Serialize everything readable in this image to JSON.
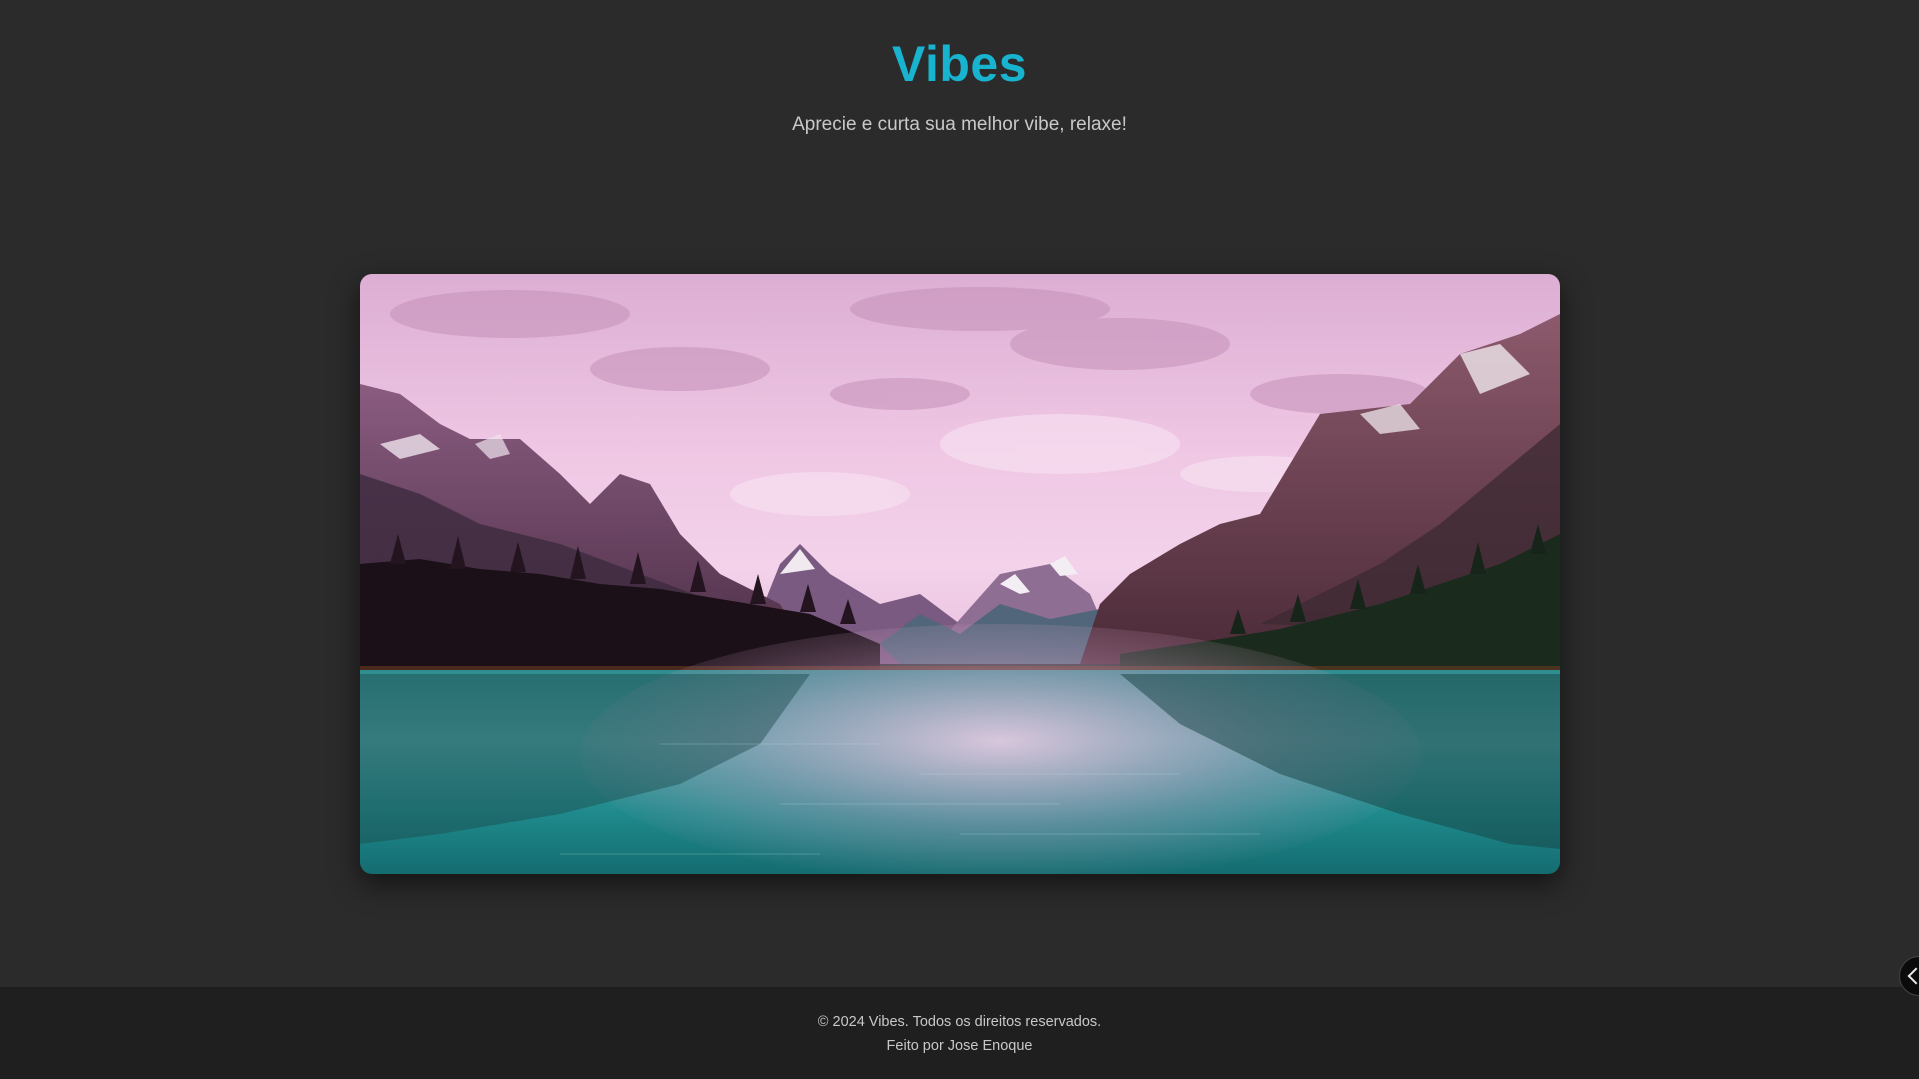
{
  "header": {
    "title": "Vibes",
    "subtitle": "Aprecie e curta sua melhor vibe, relaxe!"
  },
  "hero": {
    "image": "mountain-lake-landscape"
  },
  "footer": {
    "copyright": "© 2024 Vibes. Todos os direitos reservados.",
    "credit": "Feito por Jose Enoque"
  },
  "side_toggle": {
    "icon": "chevron-left-icon"
  },
  "colors": {
    "background": "#2b2b2b",
    "footer_background": "#1f1f1f",
    "accent": "#17b3cf",
    "text_muted": "#c9c9c9"
  }
}
